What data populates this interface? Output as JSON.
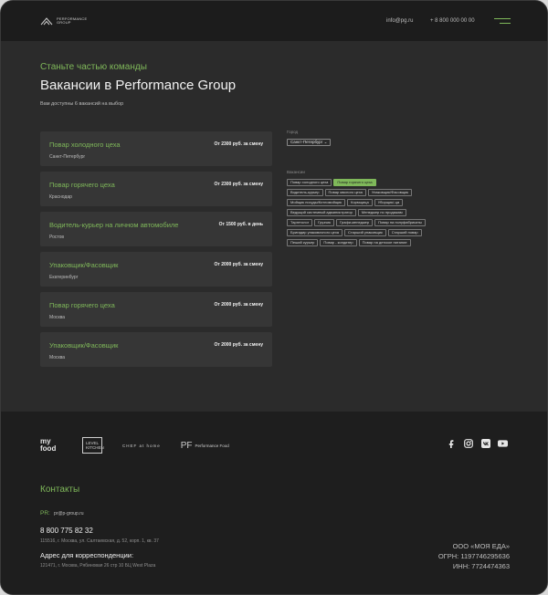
{
  "header": {
    "logo_text": "PERFORMANCE\nGROUP",
    "email": "info@pg.ru",
    "phone": "+ 8 800 000 00 00"
  },
  "hero": {
    "kicker": "Станьте частью команды",
    "title": "Вакансии в Performance Group",
    "subtitle": "Вам доступны 6 вакансий на выбор"
  },
  "vacancies": [
    {
      "title": "Повар холодного цеха",
      "city": "Санкт-Петербург",
      "salary": "От 2300 руб. за смену"
    },
    {
      "title": "Повар горячего цеха",
      "city": "Краснодар",
      "salary": "От 2300 руб. за смену"
    },
    {
      "title": "Водитель-курьер на личном автомобиле",
      "city": "Ростов",
      "salary": "От 1500 руб. в день"
    },
    {
      "title": "Упаковщик/Фасовщик",
      "city": "Екатеринбург",
      "salary": "От 2000 руб. за смену"
    },
    {
      "title": "Повар горячего цеха",
      "city": "Москва",
      "salary": "От 2000 руб. за смену"
    },
    {
      "title": "Упаковщик/Фасовщик",
      "city": "Москва",
      "salary": "От 2000 руб. за смену"
    }
  ],
  "filters": {
    "city_label": "Город",
    "city_value": "Санкт-Петербург",
    "vacancy_label": "Вакансии",
    "tag_rows": [
      [
        "Повар холодного цеха",
        "Повар горячего цеха"
      ],
      [
        "Водитель-курьер",
        "Повар мясного цеха",
        "Упаковщик/Фасовщик"
      ],
      [
        "Мойщик посуды/Котломойщик",
        "Кормщица",
        "Уборщик/-ца"
      ],
      [
        "Ведущий системный администратор",
        "Менеджер по продажам"
      ],
      [
        "Таргетолог",
        "Грузчик",
        "Графи-менеджер",
        "Повар на полуфабрикаты"
      ],
      [
        "Бригадир упаковочного цеха",
        "Старший упаковщик",
        "Старший повар"
      ],
      [
        "Пеший курьер",
        "Повар - кондитер",
        "Повар на детское питание"
      ]
    ],
    "active_tag": "Повар горячего цеха"
  },
  "footer": {
    "brands": {
      "myfood": "my food",
      "level": "LEVEL KITCHEN",
      "chef": "CHEF at home",
      "pg": "Performance Food"
    },
    "socials": [
      "facebook-icon",
      "instagram-icon",
      "vk-icon",
      "youtube-icon"
    ],
    "contacts_title": "Контакты",
    "pr_label": "PR:",
    "pr_email": "pr@p-group.ru",
    "phone": "8 800 775 82 32",
    "address": "115516, г. Москва, ул. Салтаевская, д. 52, корп. 1, кв. 37",
    "corr_title": "Адрес для корреспонденции:",
    "corr_address": "121471, г. Москва, Рябиновая 26 стр 10 БЦ West Plaza",
    "company": "ООО «МОЯ ЕДА»",
    "ogrn": "ОГРН: 1197746295636",
    "inn": "ИНН: 7724474363"
  },
  "colors": {
    "accent": "#7fb85a",
    "background": "#2b2b2b",
    "card": "#363636",
    "header": "#1c1c1c"
  }
}
